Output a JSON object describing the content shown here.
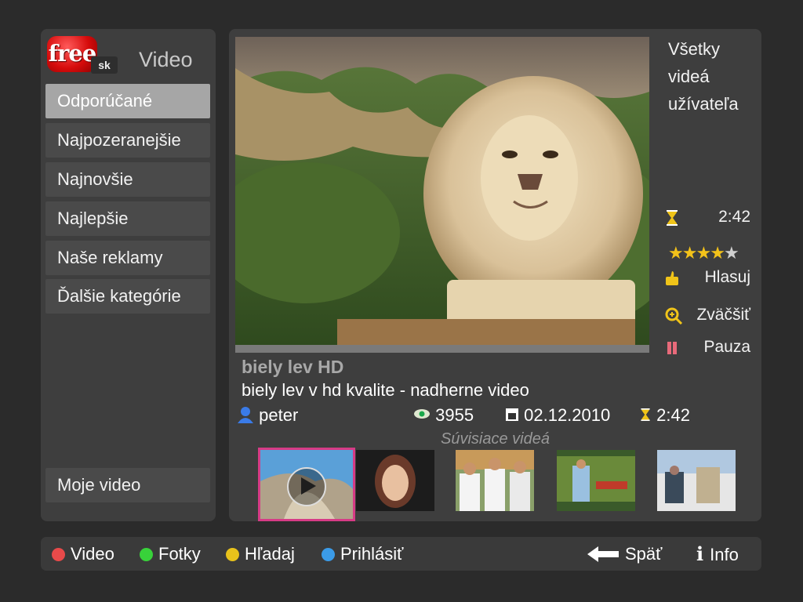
{
  "colors": {
    "background": "#2b2b2b",
    "panel": "#3e3e3e",
    "menu_active": "#a6a6a6",
    "selected_thumb": "#d63b86",
    "red": "#e84a4a",
    "green": "#38d23a",
    "yellow": "#e8c21b",
    "blue": "#3b9be8"
  },
  "logo": {
    "main": "free",
    "suffix": "sk"
  },
  "section_title": "Video",
  "menu": [
    {
      "label": "Odporúčané",
      "active": true
    },
    {
      "label": "Najpozeranejšie"
    },
    {
      "label": "Najnovšie"
    },
    {
      "label": "Najlepšie"
    },
    {
      "label": "Naše reklamy"
    },
    {
      "label": "Ďalšie kategórie"
    }
  ],
  "my_video": "Moje video",
  "sidebar": {
    "all_videos_line1": "Všetky",
    "all_videos_line2": "videá",
    "all_videos_line3": "užívateľa",
    "duration": "2:42",
    "rating_stars": 4,
    "rating_max": 5,
    "vote": "Hlasuj",
    "zoom": "Zväčšiť",
    "pause": "Pauza",
    "icons": [
      "hourglass-icon",
      "thumbs-up-icon",
      "magnifier-icon",
      "pause-icon"
    ]
  },
  "video": {
    "title": "biely lev HD",
    "description": "biely lev v hd kvalite - nadherne video",
    "author": "peter",
    "views": "3955",
    "date": "02.12.2010",
    "duration": "2:42",
    "progress": 0.0
  },
  "related": {
    "heading": "Súvisiace videá"
  },
  "bottom_bar": {
    "video": "Video",
    "photos": "Fotky",
    "search": "Hľadaj",
    "login": "Prihlásiť",
    "back": "Späť",
    "info": "Info"
  }
}
